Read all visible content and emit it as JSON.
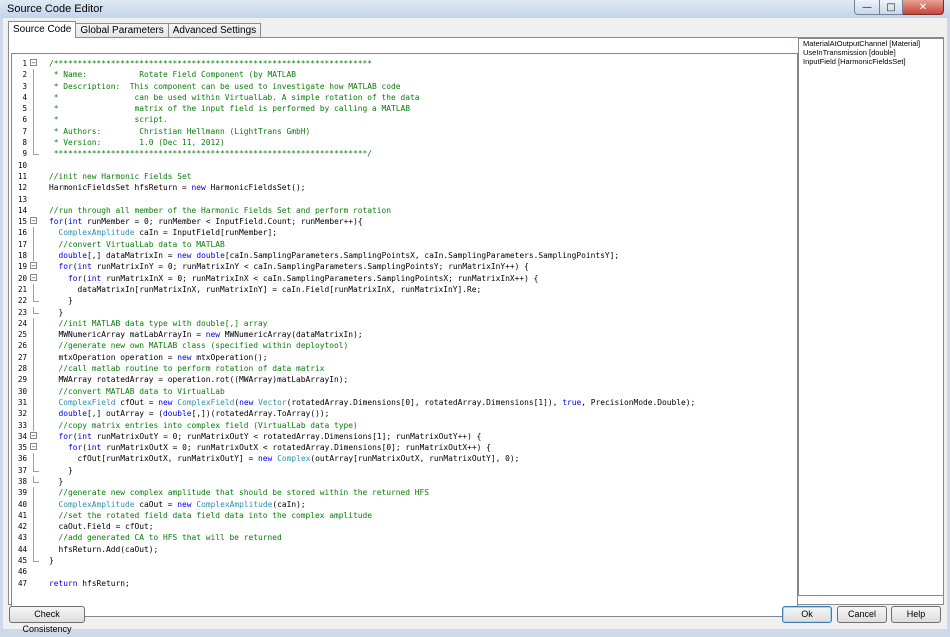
{
  "window": {
    "title": "Source Code Editor",
    "minimize": "—",
    "maximize": "□",
    "close": "✕"
  },
  "tabs": [
    {
      "label": "Source Code",
      "active": true
    },
    {
      "label": "Global Parameters",
      "active": false
    },
    {
      "label": "Advanced Settings",
      "active": false
    }
  ],
  "editor": {
    "lines": [
      {
        "n": "1",
        "fold": "minus",
        "cls": "comment",
        "text": "/*******************************************************************"
      },
      {
        "n": "2",
        "fold": "line",
        "cls": "comment",
        "text": " * Name:           Rotate Field Component (by MATLAB"
      },
      {
        "n": "3",
        "fold": "line",
        "cls": "comment",
        "text": " * Description:  This component can be used to investigate how MATLAB code"
      },
      {
        "n": "4",
        "fold": "line",
        "cls": "comment",
        "text": " *                can be used within VirtualLab. A simple rotation of the data"
      },
      {
        "n": "5",
        "fold": "line",
        "cls": "comment",
        "text": " *                matrix of the input field is performed by calling a MATLAB"
      },
      {
        "n": "6",
        "fold": "line",
        "cls": "comment",
        "text": " *                script."
      },
      {
        "n": "7",
        "fold": "line",
        "cls": "comment",
        "text": " * Authors:        Christian Hellmann (LightTrans GmbH)"
      },
      {
        "n": "8",
        "fold": "line",
        "cls": "comment",
        "text": " * Version:        1.0 (Dec 11, 2012)"
      },
      {
        "n": "9",
        "fold": "end",
        "cls": "comment",
        "text": " ******************************************************************/"
      },
      {
        "n": "10",
        "fold": "",
        "cls": "",
        "text": ""
      },
      {
        "n": "11",
        "fold": "",
        "cls": "comment",
        "text": "//init new Harmonic Fields Set"
      },
      {
        "n": "12",
        "fold": "",
        "cls": "",
        "text": "HarmonicFieldsSet hfsReturn = new HarmonicFieldsSet();"
      },
      {
        "n": "13",
        "fold": "",
        "cls": "",
        "text": ""
      },
      {
        "n": "14",
        "fold": "",
        "cls": "comment",
        "text": "//run through all member of the Harmonic Fields Set and perform rotation"
      },
      {
        "n": "15",
        "fold": "minus",
        "cls": "",
        "text": "for(int runMember = 0; runMember < InputField.Count; runMember++){"
      },
      {
        "n": "16",
        "fold": "line",
        "cls": "",
        "text": "  ComplexAmplitude caIn = InputField[runMember];"
      },
      {
        "n": "17",
        "fold": "line",
        "cls": "comment",
        "text": "  //convert VirtualLab data to MATLAB"
      },
      {
        "n": "18",
        "fold": "line",
        "cls": "",
        "text": "  double[,] dataMatrixIn = new double[caIn.SamplingParameters.SamplingPointsX, caIn.SamplingParameters.SamplingPointsY];"
      },
      {
        "n": "19",
        "fold": "minus",
        "cls": "",
        "text": "  for(int runMatrixInY = 0; runMatrixInY < caIn.SamplingParameters.SamplingPointsY; runMatrixInY++) {"
      },
      {
        "n": "20",
        "fold": "minus",
        "cls": "",
        "text": "    for(int runMatrixInX = 0; runMatrixInX < caIn.SamplingParameters.SamplingPointsX; runMatrixInX++) {"
      },
      {
        "n": "21",
        "fold": "line",
        "cls": "",
        "text": "      dataMatrixIn[runMatrixInX, runMatrixInY] = caIn.Field[runMatrixInX, runMatrixInY].Re;"
      },
      {
        "n": "22",
        "fold": "end",
        "cls": "",
        "text": "    }"
      },
      {
        "n": "23",
        "fold": "end",
        "cls": "",
        "text": "  }"
      },
      {
        "n": "24",
        "fold": "line",
        "cls": "comment",
        "text": "  //init MATLAB data type with double[,] array"
      },
      {
        "n": "25",
        "fold": "line",
        "cls": "",
        "text": "  MWNumericArray matLabArrayIn = new MWNumericArray(dataMatrixIn);"
      },
      {
        "n": "26",
        "fold": "line",
        "cls": "comment",
        "text": "  //generate new own MATLAB class (specified within deploytool)"
      },
      {
        "n": "27",
        "fold": "line",
        "cls": "",
        "text": "  mtxOperation operation = new mtxOperation();"
      },
      {
        "n": "28",
        "fold": "line",
        "cls": "comment",
        "text": "  //call matlab routine to perform rotation of data matrix"
      },
      {
        "n": "29",
        "fold": "line",
        "cls": "",
        "text": "  MWArray rotatedArray = operation.rot((MWArray)matLabArrayIn);"
      },
      {
        "n": "30",
        "fold": "line",
        "cls": "comment",
        "text": "  //convert MATLAB data to VirtualLab"
      },
      {
        "n": "31",
        "fold": "line",
        "cls": "",
        "text": "  ComplexField cfOut = new ComplexField(new Vector(rotatedArray.Dimensions[0], rotatedArray.Dimensions[1]), true, PrecisionMode.Double);"
      },
      {
        "n": "32",
        "fold": "line",
        "cls": "",
        "text": "  double[,] outArray = (double[,])(rotatedArray.ToArray());"
      },
      {
        "n": "33",
        "fold": "line",
        "cls": "comment",
        "text": "  //copy matrix entries into complex field (VirtualLab data type)"
      },
      {
        "n": "34",
        "fold": "minus",
        "cls": "",
        "text": "  for(int runMatrixOutY = 0; runMatrixOutY < rotatedArray.Dimensions[1]; runMatrixOutY++) {"
      },
      {
        "n": "35",
        "fold": "minus",
        "cls": "",
        "text": "    for(int runMatrixOutX = 0; runMatrixOutX < rotatedArray.Dimensions[0]; runMatrixOutX++) {"
      },
      {
        "n": "36",
        "fold": "line",
        "cls": "",
        "text": "      cfOut[runMatrixOutX, runMatrixOutY] = new Complex(outArray[runMatrixOutX, runMatrixOutY], 0);"
      },
      {
        "n": "37",
        "fold": "end",
        "cls": "",
        "text": "    }"
      },
      {
        "n": "38",
        "fold": "end",
        "cls": "",
        "text": "  }"
      },
      {
        "n": "39",
        "fold": "line",
        "cls": "comment",
        "text": "  //generate new complex amplitude that should be stored within the returned HFS"
      },
      {
        "n": "40",
        "fold": "line",
        "cls": "",
        "text": "  ComplexAmplitude caOut = new ComplexAmplitude(caIn);"
      },
      {
        "n": "41",
        "fold": "line",
        "cls": "comment",
        "text": "  //set the rotated field data field data into the complex amplitude"
      },
      {
        "n": "42",
        "fold": "line",
        "cls": "",
        "text": "  caOut.Field = cfOut;"
      },
      {
        "n": "43",
        "fold": "line",
        "cls": "comment",
        "text": "  //add generated CA to HFS that will be returned"
      },
      {
        "n": "44",
        "fold": "line",
        "cls": "",
        "text": "  hfsReturn.Add(caOut);"
      },
      {
        "n": "45",
        "fold": "end",
        "cls": "",
        "text": "}"
      },
      {
        "n": "46",
        "fold": "",
        "cls": "",
        "text": ""
      },
      {
        "n": "47",
        "fold": "",
        "cls": "",
        "text": "return hfsReturn;"
      }
    ]
  },
  "parameters": [
    "MaterialAtOutputChannel [Material]",
    "UseInTransmission [double]",
    "InputField [HarmonicFieldsSet]"
  ],
  "buttons": {
    "check": "Check Consistency",
    "ok": "Ok",
    "cancel": "Cancel",
    "help": "Help"
  }
}
